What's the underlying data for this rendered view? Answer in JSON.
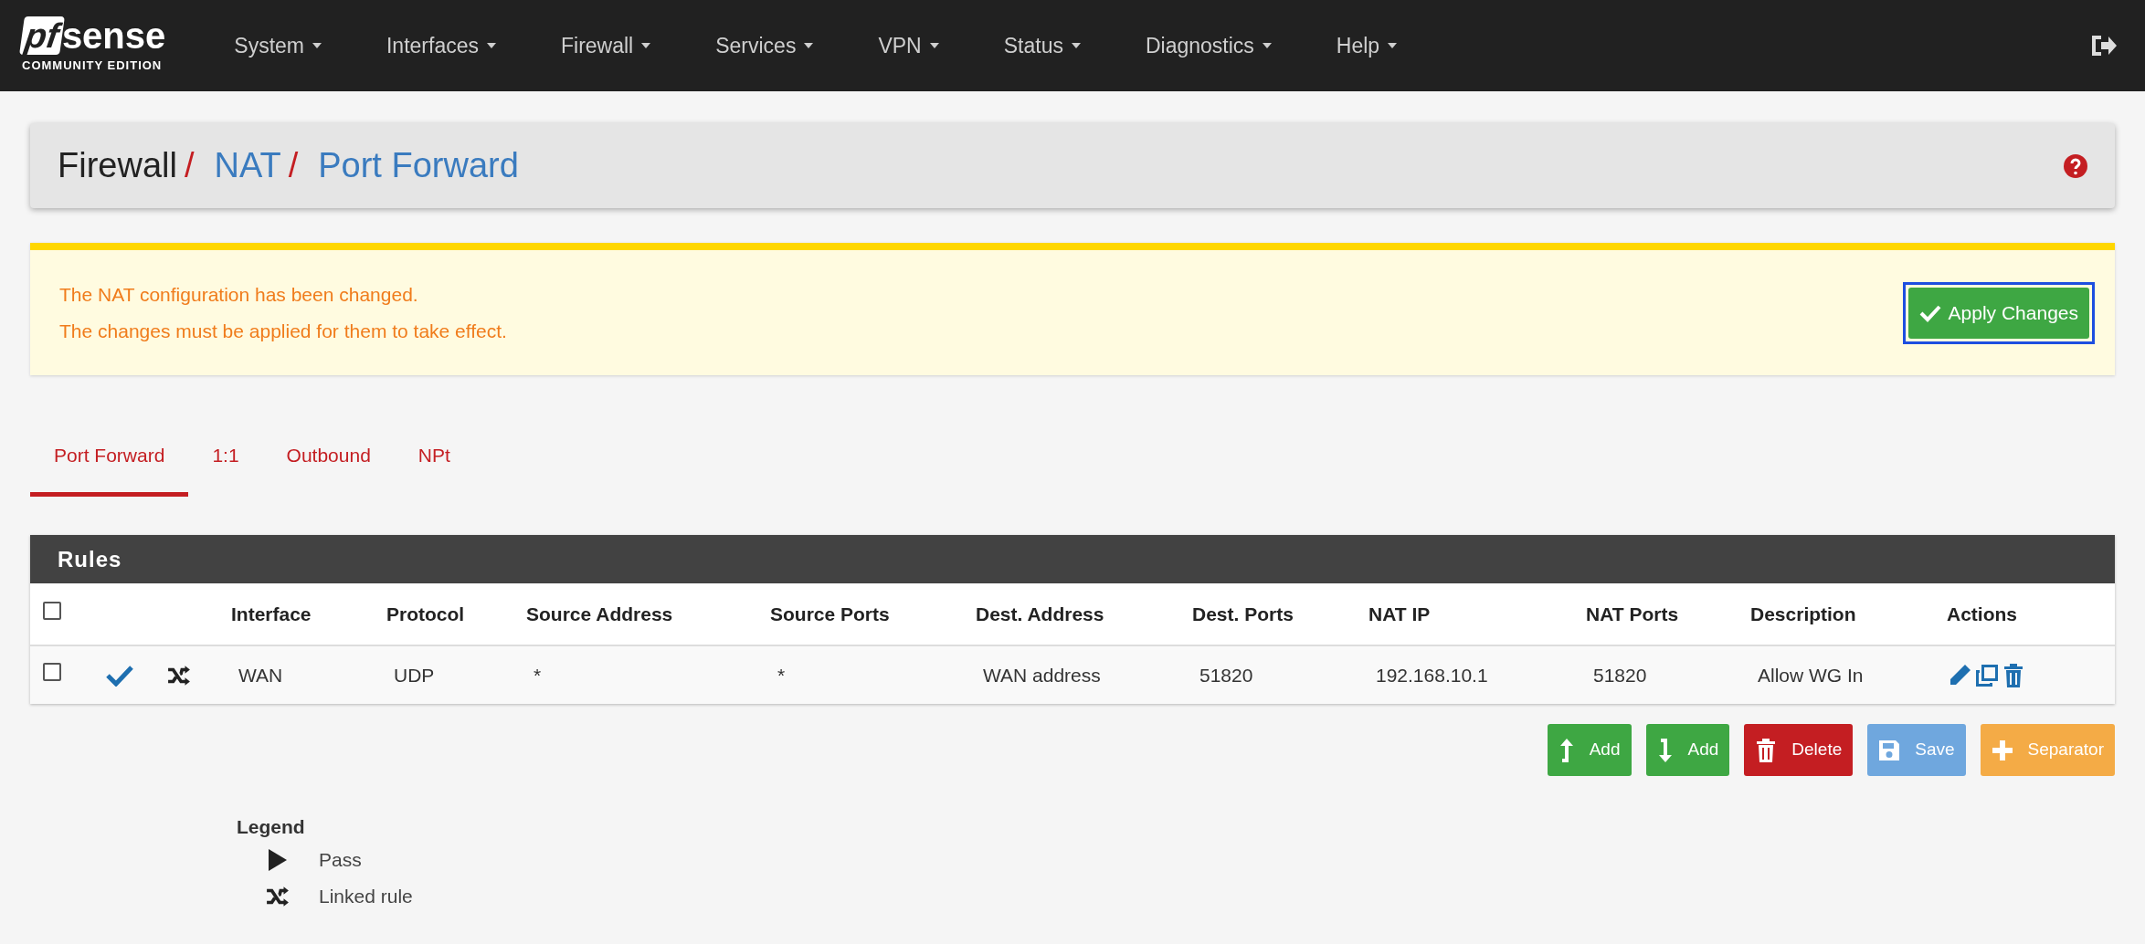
{
  "navbar": {
    "logo": {
      "mark": "pf",
      "name": "sense",
      "edition": "COMMUNITY EDITION"
    },
    "menu": [
      {
        "label": "System"
      },
      {
        "label": "Interfaces"
      },
      {
        "label": "Firewall"
      },
      {
        "label": "Services"
      },
      {
        "label": "VPN"
      },
      {
        "label": "Status"
      },
      {
        "label": "Diagnostics"
      },
      {
        "label": "Help"
      }
    ]
  },
  "breadcrumb": [
    {
      "label": "Firewall",
      "kind": "text"
    },
    {
      "separator": "/",
      "label": "NAT",
      "kind": "link"
    },
    {
      "separator": "/",
      "label": "Port Forward",
      "kind": "link"
    }
  ],
  "alert": {
    "lines": [
      "The NAT configuration has been changed.",
      "The changes must be applied for them to take effect."
    ],
    "button": "Apply Changes"
  },
  "tabs": [
    {
      "label": "Port Forward",
      "selected": true
    },
    {
      "label": "1:1",
      "selected": false
    },
    {
      "label": "Outbound",
      "selected": false
    },
    {
      "label": "NPt",
      "selected": false
    }
  ],
  "rules": {
    "title": "Rules",
    "select_all_checked": false,
    "columns": [
      "Interface",
      "Protocol",
      "Source Address",
      "Source Ports",
      "Dest. Address",
      "Dest. Ports",
      "NAT IP",
      "NAT Ports",
      "Description",
      "Actions"
    ],
    "rows": [
      {
        "checked": false,
        "enabled": true,
        "linked": true,
        "cells": [
          "WAN",
          "UDP",
          "*",
          "*",
          "WAN address",
          "51820",
          "192.168.10.1",
          "51820",
          "Allow WG In"
        ]
      }
    ]
  },
  "buttons": [
    {
      "label": "Add",
      "kind": "add-top"
    },
    {
      "label": "Add",
      "kind": "add-bottom"
    },
    {
      "label": "Delete",
      "kind": "delete"
    },
    {
      "label": "Save",
      "kind": "save"
    },
    {
      "label": "Separator",
      "kind": "separator"
    }
  ],
  "legend": {
    "title": "Legend",
    "items": [
      {
        "label": "Pass",
        "kind": "pass"
      },
      {
        "label": "Linked rule",
        "kind": "linked"
      }
    ]
  }
}
